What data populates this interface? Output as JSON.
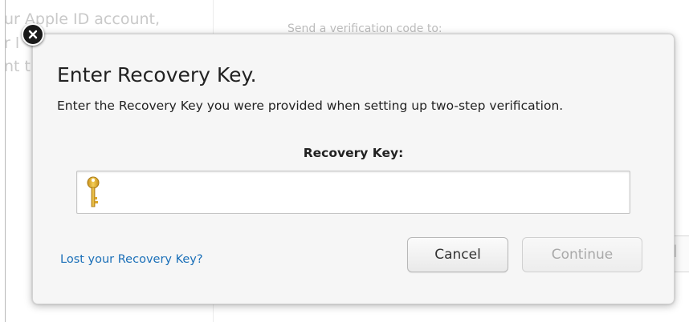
{
  "background": {
    "line1": "ur Apple ID account,",
    "line2": "r l",
    "line3": "nt t",
    "send_code_label": "Send a verification code to:",
    "right_button_glyph": "l"
  },
  "dialog": {
    "close_icon": "close-icon",
    "title": "Enter Recovery Key.",
    "description": "Enter the Recovery Key you were provided when setting up two-step verification.",
    "field_label": "Recovery Key:",
    "input_value": "",
    "input_icon": "key-icon",
    "lost_link": "Lost your Recovery Key?",
    "cancel_label": "Cancel",
    "continue_label": "Continue",
    "continue_enabled": false
  },
  "colors": {
    "link": "#1a6fb8",
    "disabled_text": "#a9a9a9",
    "key_gold": "#e3b32b"
  }
}
